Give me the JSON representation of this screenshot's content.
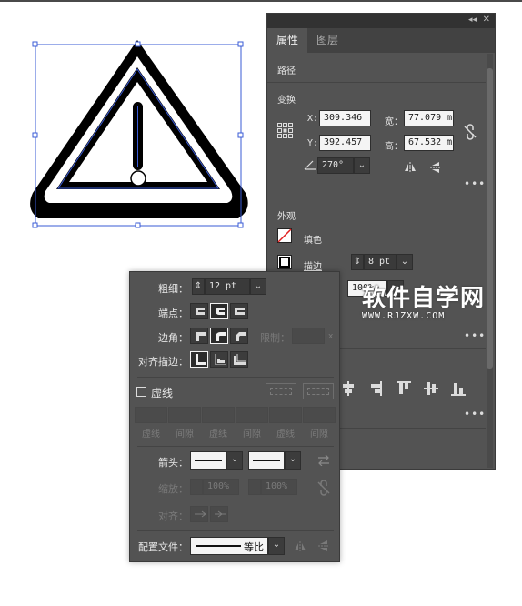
{
  "properties_panel": {
    "tabs": [
      {
        "label": "属性"
      },
      {
        "label": "图层"
      }
    ],
    "object_type": "路径",
    "transform": {
      "title": "变换",
      "x_label": "X:",
      "x_value": "309.346",
      "y_label": "Y:",
      "y_value": "392.457",
      "width_label": "宽：",
      "width_value": "77.079 m",
      "height_label": "高：",
      "height_value": "67.532 m",
      "angle_value": "270°"
    },
    "appearance": {
      "title": "外观",
      "fill_label": "填色",
      "stroke_label": "描边",
      "stroke_value": "8 pt",
      "opacity_value": "100%"
    }
  },
  "stroke_panel": {
    "weight_label": "粗细：",
    "weight_value": "12 pt",
    "cap_label": "端点：",
    "corner_label": "边角：",
    "limit_label": "限制：",
    "limit_suffix": "x",
    "align_label": "对齐描边：",
    "dashed_label": "虚线",
    "dash_labels": [
      "虚线",
      "间隙",
      "虚线",
      "间隙",
      "虚线",
      "间隙"
    ],
    "arrow_label": "箭头：",
    "scale_label": "缩放：",
    "scale_start": "100%",
    "scale_end": "100%",
    "align_arrow_label": "对齐：",
    "profile_label": "配置文件：",
    "profile_value": "等比"
  },
  "watermark": {
    "main": "软件自学网",
    "sub": "WWW.RJZXW.COM"
  },
  "colors": {
    "panel_bg": "#535353",
    "selection_blue": "#3a5bd6",
    "artwork": "#000000"
  }
}
